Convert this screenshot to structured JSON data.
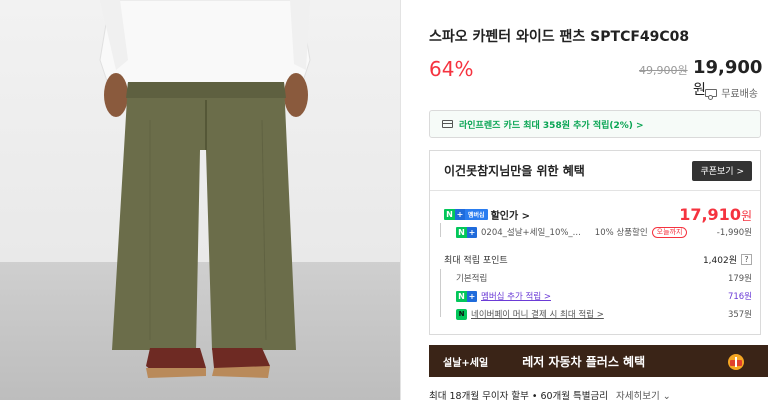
{
  "product": {
    "title": "스파오 카펜터 와이드 팬츠 SPTCF49C08",
    "discount": "64%",
    "original_price": "49,900원",
    "sale_price": "19,900",
    "sale_unit": "원",
    "shipping": "무료배송"
  },
  "card_banner": {
    "text": "라인프렌즈 카드 최대 358원 추가 적립(2%) >"
  },
  "benefit": {
    "title": "이건못참지님만을 위한 혜택",
    "coupon_button": "쿠폰보기 >",
    "discounted_label": "할인가 >",
    "discounted_price": "17,910",
    "price_unit": "원",
    "coupon_name": "0204_설날+세일_10%_...",
    "coupon_rate": "10% 상품할인",
    "coupon_badge": "오늘까지",
    "coupon_amount": "-1,990원",
    "point_label": "최대 적립 포인트",
    "point_total": "1,402원",
    "point_help": "?",
    "basic_label": "기본적립",
    "basic_value": "179원",
    "membership_label": "멤버십 추가 적립 >",
    "membership_value": "716원",
    "pay_label": "네이버페이 머니 결제 시 최대 적립 >",
    "pay_value": "357원",
    "badge_n": "N",
    "badge_plus": "+",
    "badge_membership": "멤버십",
    "badge_pay": "N"
  },
  "promo": {
    "tag": "설날+세일",
    "text": "레저 자동차 플러스 혜택"
  },
  "installment": {
    "text": "최대 18개월 무이자 할부 • 60개월 특별금리",
    "link": "자세히보기 ⌄"
  },
  "colors": {
    "accent_red": "#f5333f",
    "naver_green": "#03c75a",
    "promo_bg": "#3a2417"
  }
}
